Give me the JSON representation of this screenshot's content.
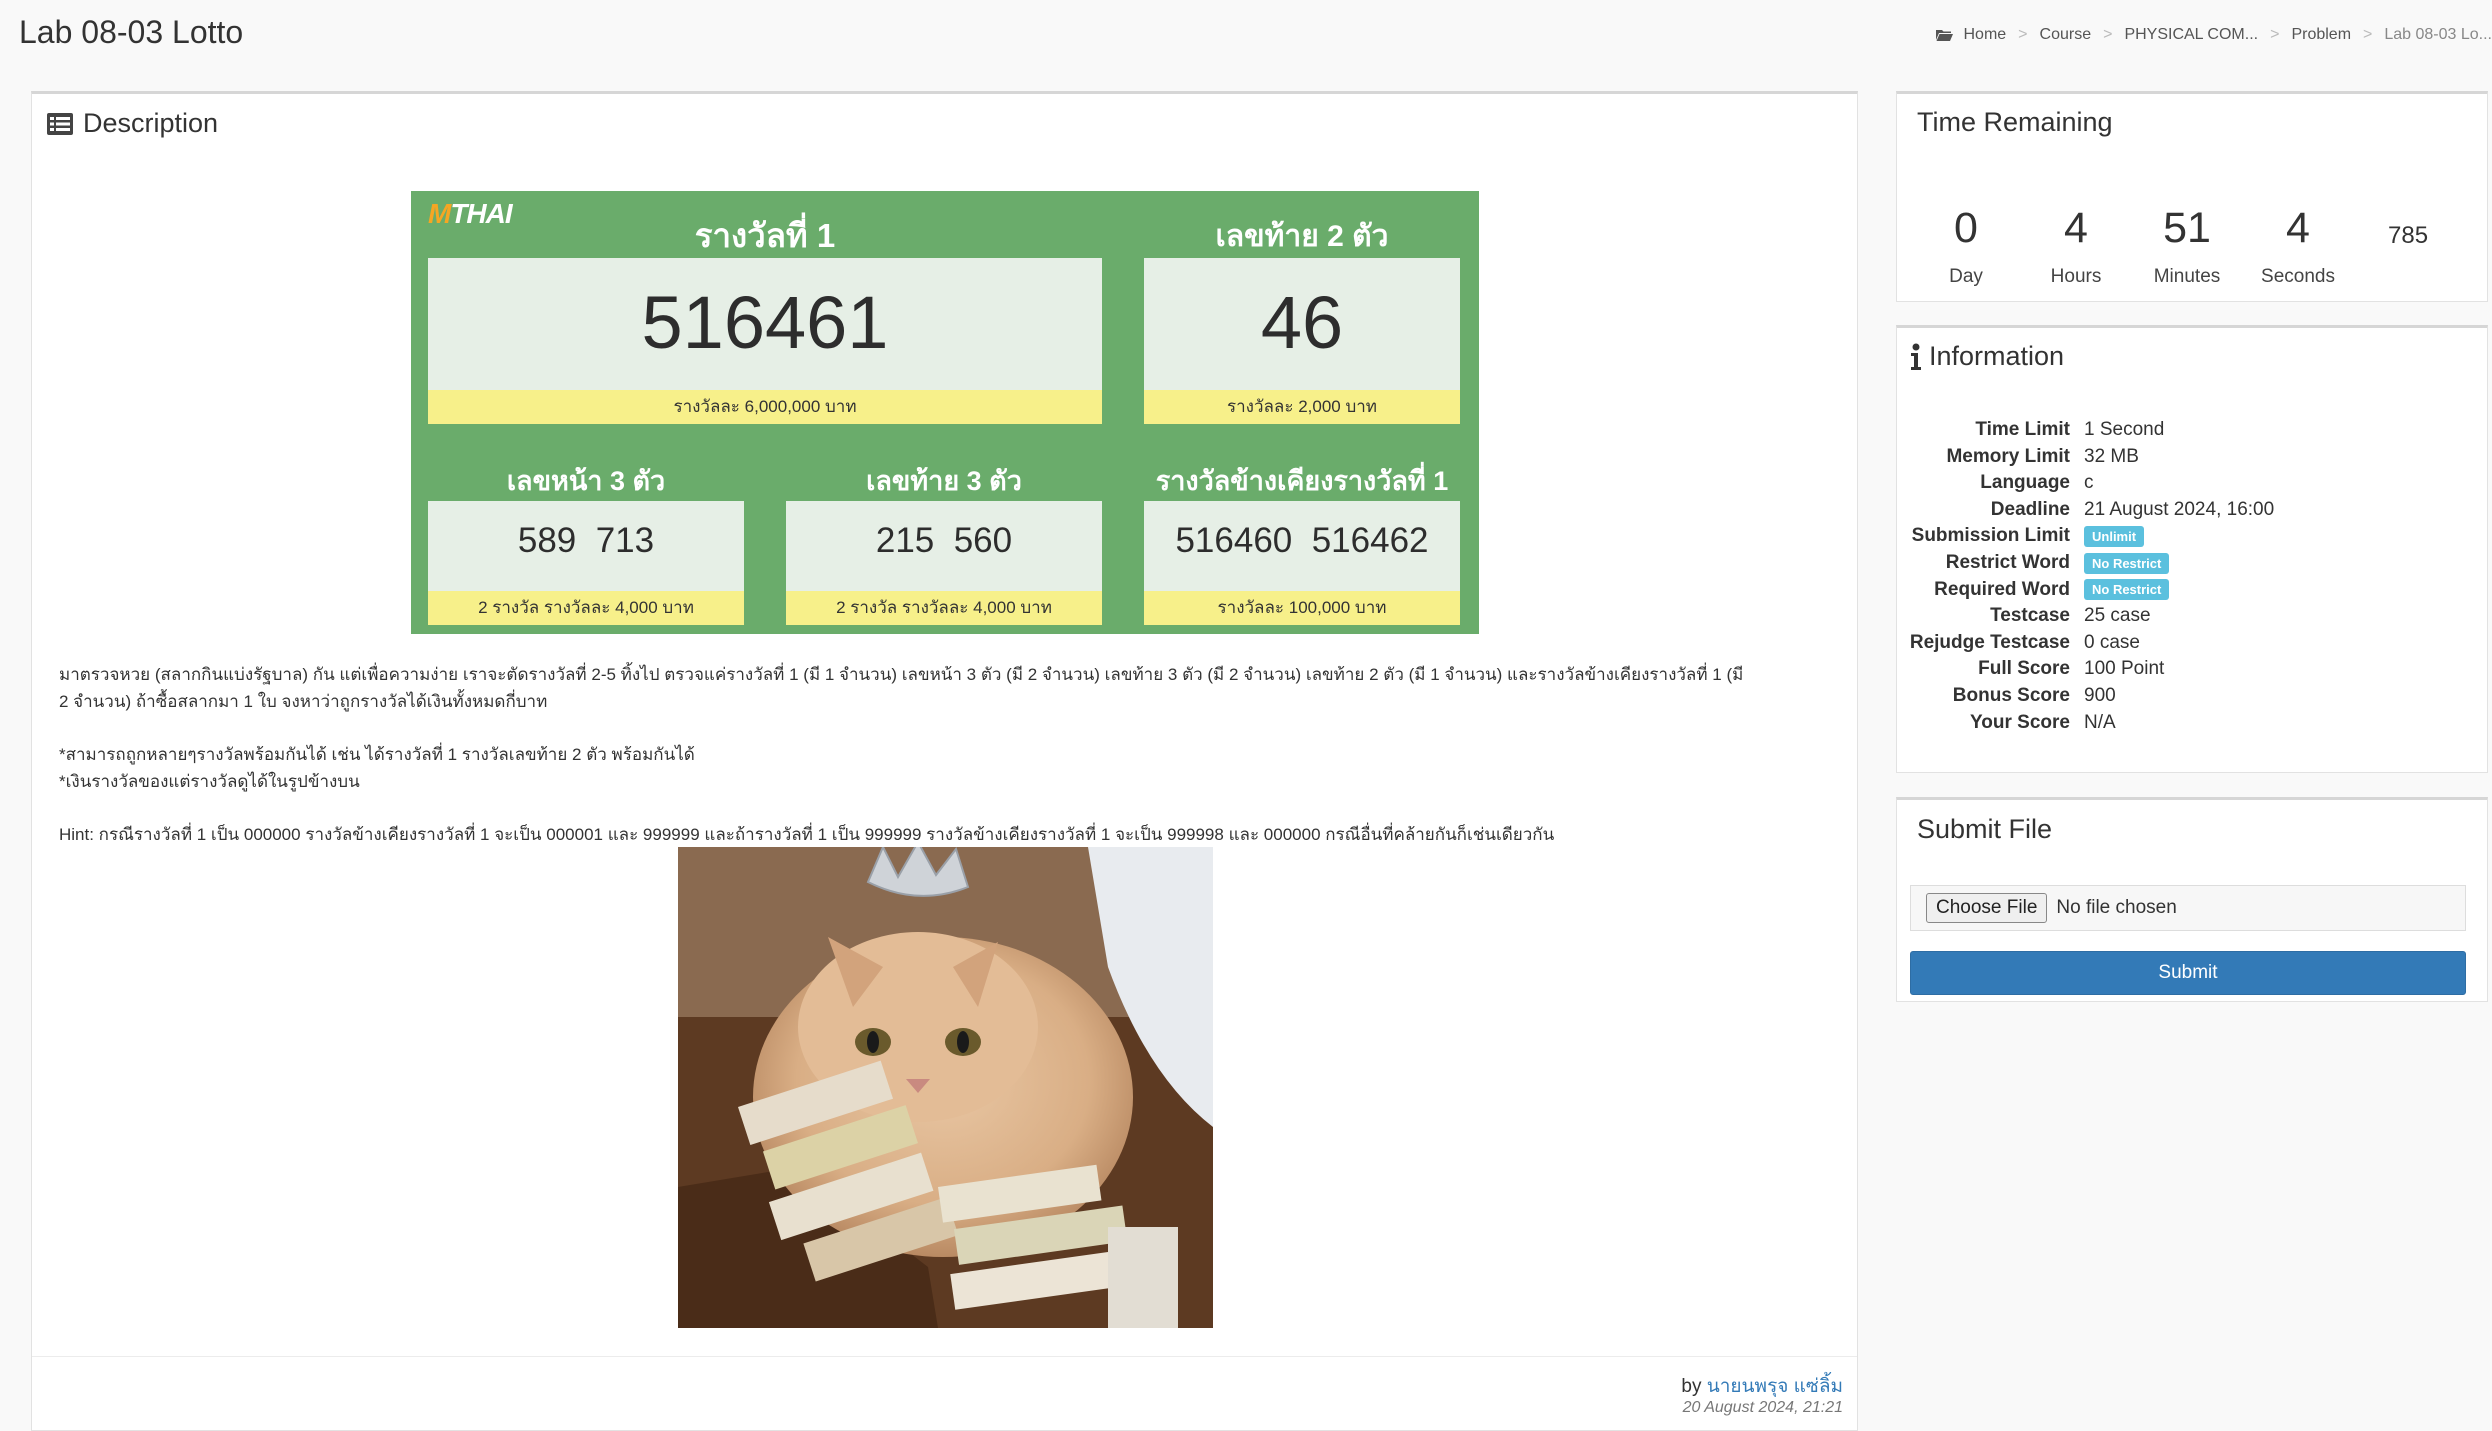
{
  "page_title": "Lab 08-03 Lotto",
  "breadcrumb": {
    "home": "Home",
    "course": "Course",
    "physical": "PHYSICAL COM...",
    "problem": "Problem",
    "current": "Lab 08-03 Lo..."
  },
  "description": {
    "title": "Description",
    "lotto": {
      "logo_m": "M",
      "logo_rest": "THAI",
      "first_prize_title": "รางวัลที่ 1",
      "first_prize_number": "516461",
      "first_prize_reward": "รางวัลละ 6,000,000 บาท",
      "last2_title": "เลขท้าย 2 ตัว",
      "last2_number": "46",
      "last2_reward": "รางวัลละ 2,000 บาท",
      "front3_title": "เลขหน้า 3 ตัว",
      "front3_numbers": "589  713",
      "front3_reward": "2 รางวัล รางวัลละ 4,000 บาท",
      "back3_title": "เลขท้าย 3 ตัว",
      "back3_numbers": "215  560",
      "back3_reward": "2 รางวัล รางวัลละ 4,000 บาท",
      "near_title": "รางวัลข้างเคียงรางวัลที่ 1",
      "near_numbers": "516460  516462",
      "near_reward": "รางวัลละ 100,000 บาท"
    },
    "para1_line1": "มาตรวจหวย (สลากกินแบ่งรัฐบาล) กัน แต่เพื่อความง่าย เราจะตัดรางวัลที่ 2-5 ทิ้งไป ตรวจแค่รางวัลที่ 1 (มี 1 จำนวน) เลขหน้า 3 ตัว (มี 2 จำนวน)  เลขท้าย 3 ตัว (มี 2 จำนวน)  เลขท้าย 2 ตัว (มี 1 จำนวน)  และรางวัลข้างเคียงรางวัลที่ 1 (มี",
    "para1_line2": "2 จำนวน) ถ้าซื้อสลากมา 1 ใบ จงหาว่าถูกรางวัลได้เงินทั้งหมดกี่บาท",
    "note1": "*สามารถถูกหลายๆรางวัลพร้อมกันได้ เช่น ได้รางวัลที่ 1 รางวัลเลขท้าย 2 ตัว พร้อมกันได้",
    "note2": "*เงินรางวัลของแต่รางวัลดูได้ในรูปข้างบน",
    "hint": "Hint: กรณีรางวัลที่ 1 เป็น 000000 รางวัลข้างเคียงรางวัลที่ 1 จะเป็น 000001 และ 999999 และถ้ารางวัลที่ 1 เป็น 999999 รางวัลข้างเคียงรางวัลที่ 1 จะเป็น 999998 และ 000000 กรณีอื่นที่คล้ายกันก็เช่นเดียวกัน",
    "by_label": "by",
    "author": "นายนพรุจ แซ่ลิ้ม",
    "date": "20 August 2024, 21:21"
  },
  "time_remaining": {
    "title": "Time Remaining",
    "day": "0",
    "day_label": "Day",
    "hours": "4",
    "hours_label": "Hours",
    "minutes": "51",
    "minutes_label": "Minutes",
    "seconds": "4",
    "seconds_label": "Seconds",
    "ms": "785"
  },
  "information": {
    "title": "Information",
    "rows": [
      {
        "key": "Time Limit",
        "value": "1 Second"
      },
      {
        "key": "Memory Limit",
        "value": "32 MB"
      },
      {
        "key": "Language",
        "value": "c"
      },
      {
        "key": "Deadline",
        "value": "21 August 2024, 16:00"
      },
      {
        "key": "Submission Limit",
        "value": "Unlimit"
      },
      {
        "key": "Restrict Word",
        "value": "No Restrict"
      },
      {
        "key": "Required Word",
        "value": "No Restrict"
      },
      {
        "key": "Testcase",
        "value": "25 case"
      },
      {
        "key": "Rejudge Testcase",
        "value": "0 case"
      },
      {
        "key": "Full Score",
        "value": "100 Point"
      },
      {
        "key": "Bonus Score",
        "value": "900"
      },
      {
        "key": "Your Score",
        "value": "N/A"
      }
    ]
  },
  "submit": {
    "title": "Submit File",
    "choose_label": "Choose File",
    "no_file": "No file chosen",
    "submit_label": "Submit"
  },
  "colors": {
    "primary": "#337ab7",
    "badge": "#5bc0de",
    "lotto_green": "#6aac6b",
    "lotto_yellow": "#f7f08a"
  },
  "icons": [
    "folder-icon",
    "list-icon",
    "info-icon"
  ]
}
